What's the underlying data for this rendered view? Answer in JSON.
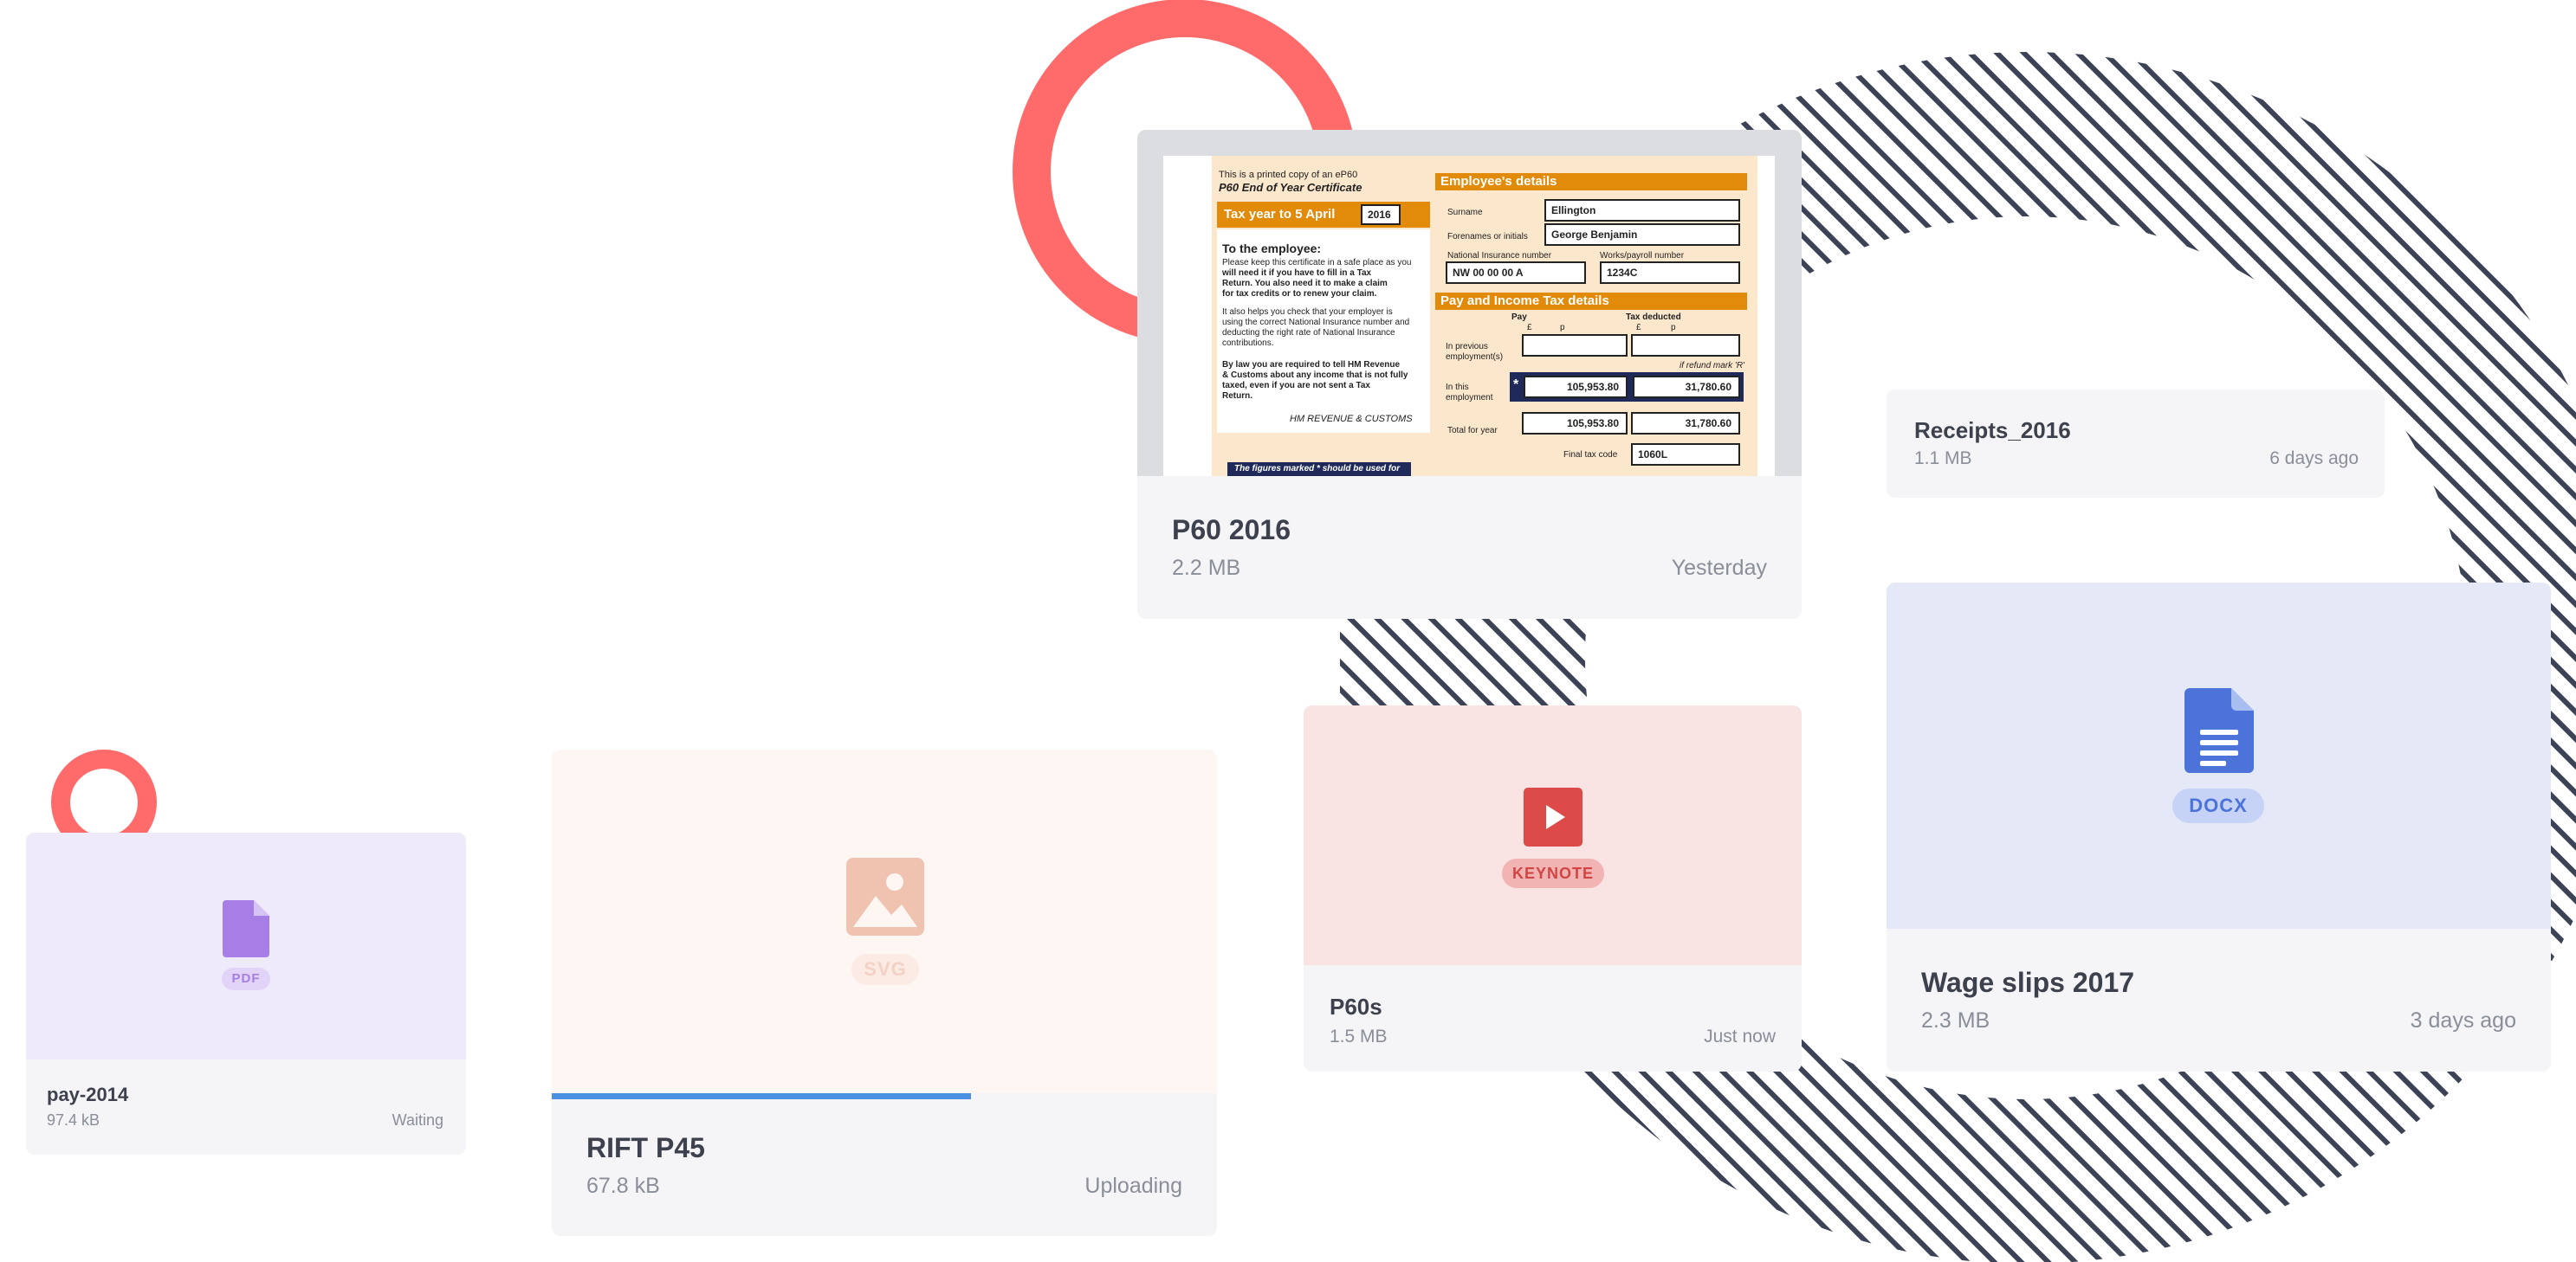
{
  "files": [
    {
      "name": "pay-2014",
      "size": "97.4 kB",
      "status": "Waiting",
      "type": "PDF"
    },
    {
      "name": "RIFT P45",
      "size": "67.8 kB",
      "status": "Uploading",
      "type": "SVG",
      "progress": 0.63
    },
    {
      "name": "P60 2016",
      "size": "2.2 MB",
      "status": "Yesterday"
    },
    {
      "name": "P60s",
      "size": "1.5 MB",
      "status": "Just now",
      "type": "KEYNOTE"
    },
    {
      "name": "Receipts_2016",
      "size": "1.1 MB",
      "status": "6 days ago"
    },
    {
      "name": "Wage slips 2017",
      "size": "2.3 MB",
      "status": "3 days ago",
      "type": "DOCX"
    }
  ],
  "p60_document": {
    "printed_copy": "This is a printed copy of an eP60",
    "title": "P60 End of Year Certificate",
    "tax_year": "Tax year to 5 April",
    "year": "2016",
    "to_employee": "To the employee:",
    "para1": [
      "Please keep this certificate in a safe place as you",
      "will need it if you have to fill in a Tax",
      "Return. You also need it to make a claim",
      "for tax credits or to renew your claim."
    ],
    "para2": [
      "It also helps you check that your employer is",
      "using the correct National Insurance number and",
      "deducting the right rate of National Insurance",
      "contributions."
    ],
    "para3": [
      "By law you are required to tell HM Revenue",
      "& Customs about any income that is not fully",
      "taxed, even if you are not sent a Tax",
      "Return."
    ],
    "hmrc": "HM REVENUE & CUSTOMS",
    "footer_note": "The figures marked * should be used for",
    "employee_details": "Employee's details",
    "surname_label": "Surname",
    "surname": "Ellington",
    "forenames_label": "Forenames or initials",
    "forenames": "George Benjamin",
    "ni_label": "National Insurance number",
    "ni_number": "NW   00   00   00   A",
    "works_label": "Works/payroll number",
    "works_number": "1234C",
    "pay_tax": "Pay and Income Tax details",
    "pay_col": "Pay",
    "tax_col": "Tax deducted",
    "pounds": "£",
    "pence": "p",
    "prev_employment": [
      "In previous",
      "employment(s)"
    ],
    "refund_mark": "if refund mark 'R'",
    "this_employment": [
      "In this",
      "employment"
    ],
    "star": "*",
    "pay_this": "105,953.80",
    "tax_this": "31,780.60",
    "total_label": "Total for year",
    "pay_total": "105,953.80",
    "tax_total": "31,780.60",
    "tax_code_label": "Final tax code",
    "tax_code": "1060L"
  },
  "colors": {
    "pdf": "#a77ee6",
    "svg": "#f0c2b0",
    "keynote": "#dd4a4a",
    "docx": "#4b73d9",
    "progress": "#4a90e2",
    "coral": "#ff6b6b",
    "stripes": "#3d4356"
  },
  "icons": [
    "document-icon",
    "image-icon",
    "play-icon",
    "google-docs-icon"
  ]
}
